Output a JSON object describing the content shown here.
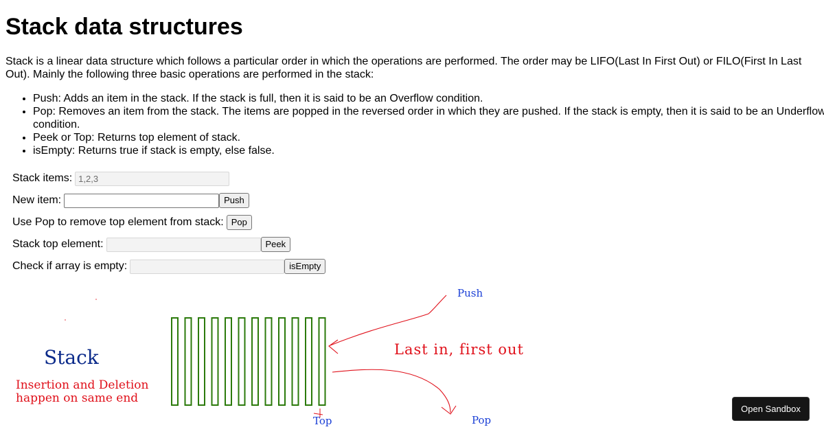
{
  "page": {
    "title": "Stack data structures",
    "intro": "Stack is a linear data structure which follows a particular order in which the operations are performed. The order may be LIFO(Last In First Out) or FILO(First In Last Out). Mainly the following three basic operations are performed in the stack:",
    "operations": [
      "Push: Adds an item in the stack. If the stack is full, then it is said to be an Overflow condition.",
      "Pop: Removes an item from the stack. The items are popped in the reversed order in which they are pushed. If the stack is empty, then it is said to be an Underflow condition.",
      "Peek or Top: Returns top element of stack.",
      "isEmpty: Returns true if stack is empty, else false."
    ]
  },
  "form": {
    "stack_items_label": "Stack items:",
    "stack_items_value": "1,2,3",
    "new_item_label": "New item:",
    "new_item_value": "",
    "push_label": "Push",
    "pop_text": "Use Pop to remove top element from stack:",
    "pop_label": "Pop",
    "top_label": "Stack top element:",
    "top_value": "",
    "peek_label": "Peek",
    "empty_label": "Check if array is empty:",
    "empty_value": "",
    "isempty_label": "isEmpty"
  },
  "diagram": {
    "stack_label": "Stack",
    "insertion_line1": "Insertion and Deletion",
    "insertion_line2": "happen on same end",
    "push_label": "Push",
    "lifo_label": "Last in, first out",
    "top_label": "Top",
    "pop_label": "Pop",
    "colors": {
      "blue": "#1a3fd6",
      "navy": "#0b2a8a",
      "red": "#e0101a",
      "green": "#2b7a0b"
    }
  },
  "sandbox": {
    "label": "Open Sandbox"
  }
}
